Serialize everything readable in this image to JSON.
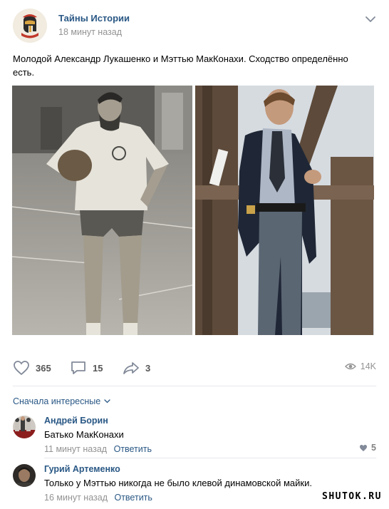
{
  "post": {
    "author": "Тайны Истории",
    "time": "18 минут назад",
    "text": "Молодой Александр Лукашенко и Мэттью МакКонахи. Сходство определённо есть.",
    "likes": "365",
    "comments": "15",
    "shares": "3",
    "views": "14K",
    "icons": {
      "avatar": "spartan-helmet-logo",
      "menu": "chevron-down-icon",
      "like": "heart-icon",
      "comment": "comment-bubble-icon",
      "share": "share-arrow-icon",
      "views": "eye-icon"
    }
  },
  "comments_section": {
    "sort_label": "Сначала интересные",
    "items": [
      {
        "author": "Андрей Борин",
        "text": "Батько МакКонахи",
        "time": "11 минут назад",
        "reply": "Ответить",
        "likes": "5"
      },
      {
        "author": "Гурий Артеменко",
        "text": "Только у Мэттью никогда не было клевой динамовской майки.",
        "time": "16 минут назад",
        "reply": "Ответить"
      }
    ]
  },
  "watermark": "SHUTOK.RU",
  "colors": {
    "link": "#2a5885",
    "muted": "#939393",
    "icon": "#828a99",
    "divider": "#e7e8ec",
    "logo_red": "#c0392b"
  }
}
